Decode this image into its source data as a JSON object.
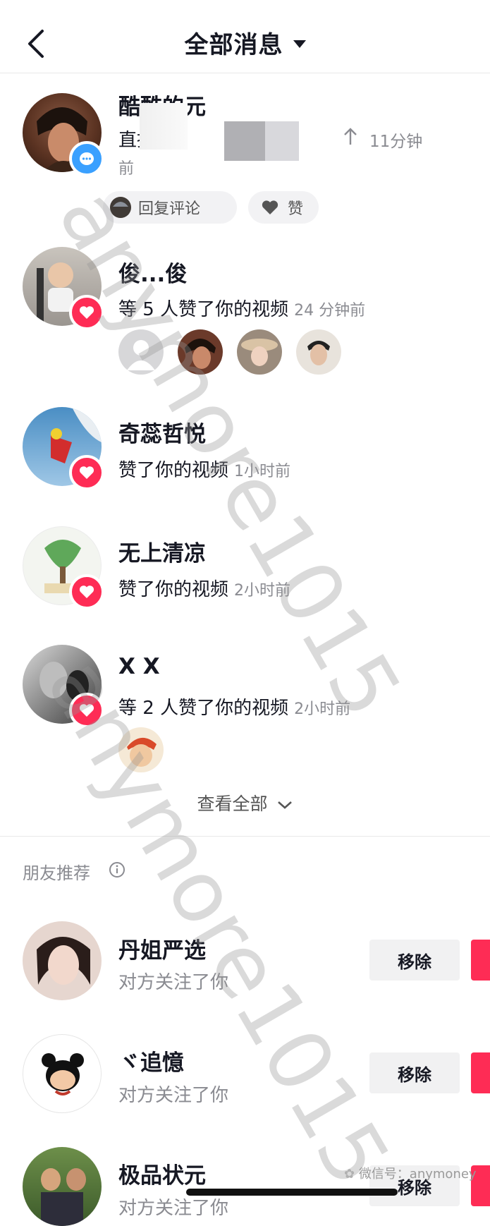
{
  "header": {
    "title": "全部消息"
  },
  "notifications": [
    {
      "name": "酷酷的元",
      "text": "直接",
      "time": "11分钟",
      "time_wrap": "前",
      "badge": "message-icon",
      "actions": [
        {
          "label": "回复评论"
        },
        {
          "label": "赞"
        }
      ]
    },
    {
      "name": "俊...俊",
      "text": "等 5 人赞了你的视频",
      "time": "24 分钟前",
      "badge": "heart-icon"
    },
    {
      "name": "奇蕊哲悦",
      "text": "赞了你的视频",
      "time": "1小时前",
      "badge": "heart-icon"
    },
    {
      "name": "无上清凉",
      "text": "赞了你的视频",
      "time": "2小时前",
      "badge": "heart-icon"
    },
    {
      "name": "X X",
      "text": "等 2 人赞了你的视频",
      "time": "2小时前",
      "badge": "heart-icon"
    }
  ],
  "view_all": "查看全部",
  "recommend": {
    "title": "朋友推荐",
    "items": [
      {
        "name": "丹姐严选",
        "sub": "对方关注了你",
        "remove": "移除"
      },
      {
        "name": "ヾ追憶",
        "sub": "对方关注了你",
        "remove": "移除"
      },
      {
        "name": "极品状元",
        "sub": "对方关注了你",
        "remove": "移除"
      }
    ]
  },
  "watermark": "anymore1015",
  "footer_watermark": "微信号：anymoney",
  "colors": {
    "accent": "#fe2c55",
    "message": "#3aa0ff",
    "text": "#161823",
    "muted": "#8a8b91"
  }
}
